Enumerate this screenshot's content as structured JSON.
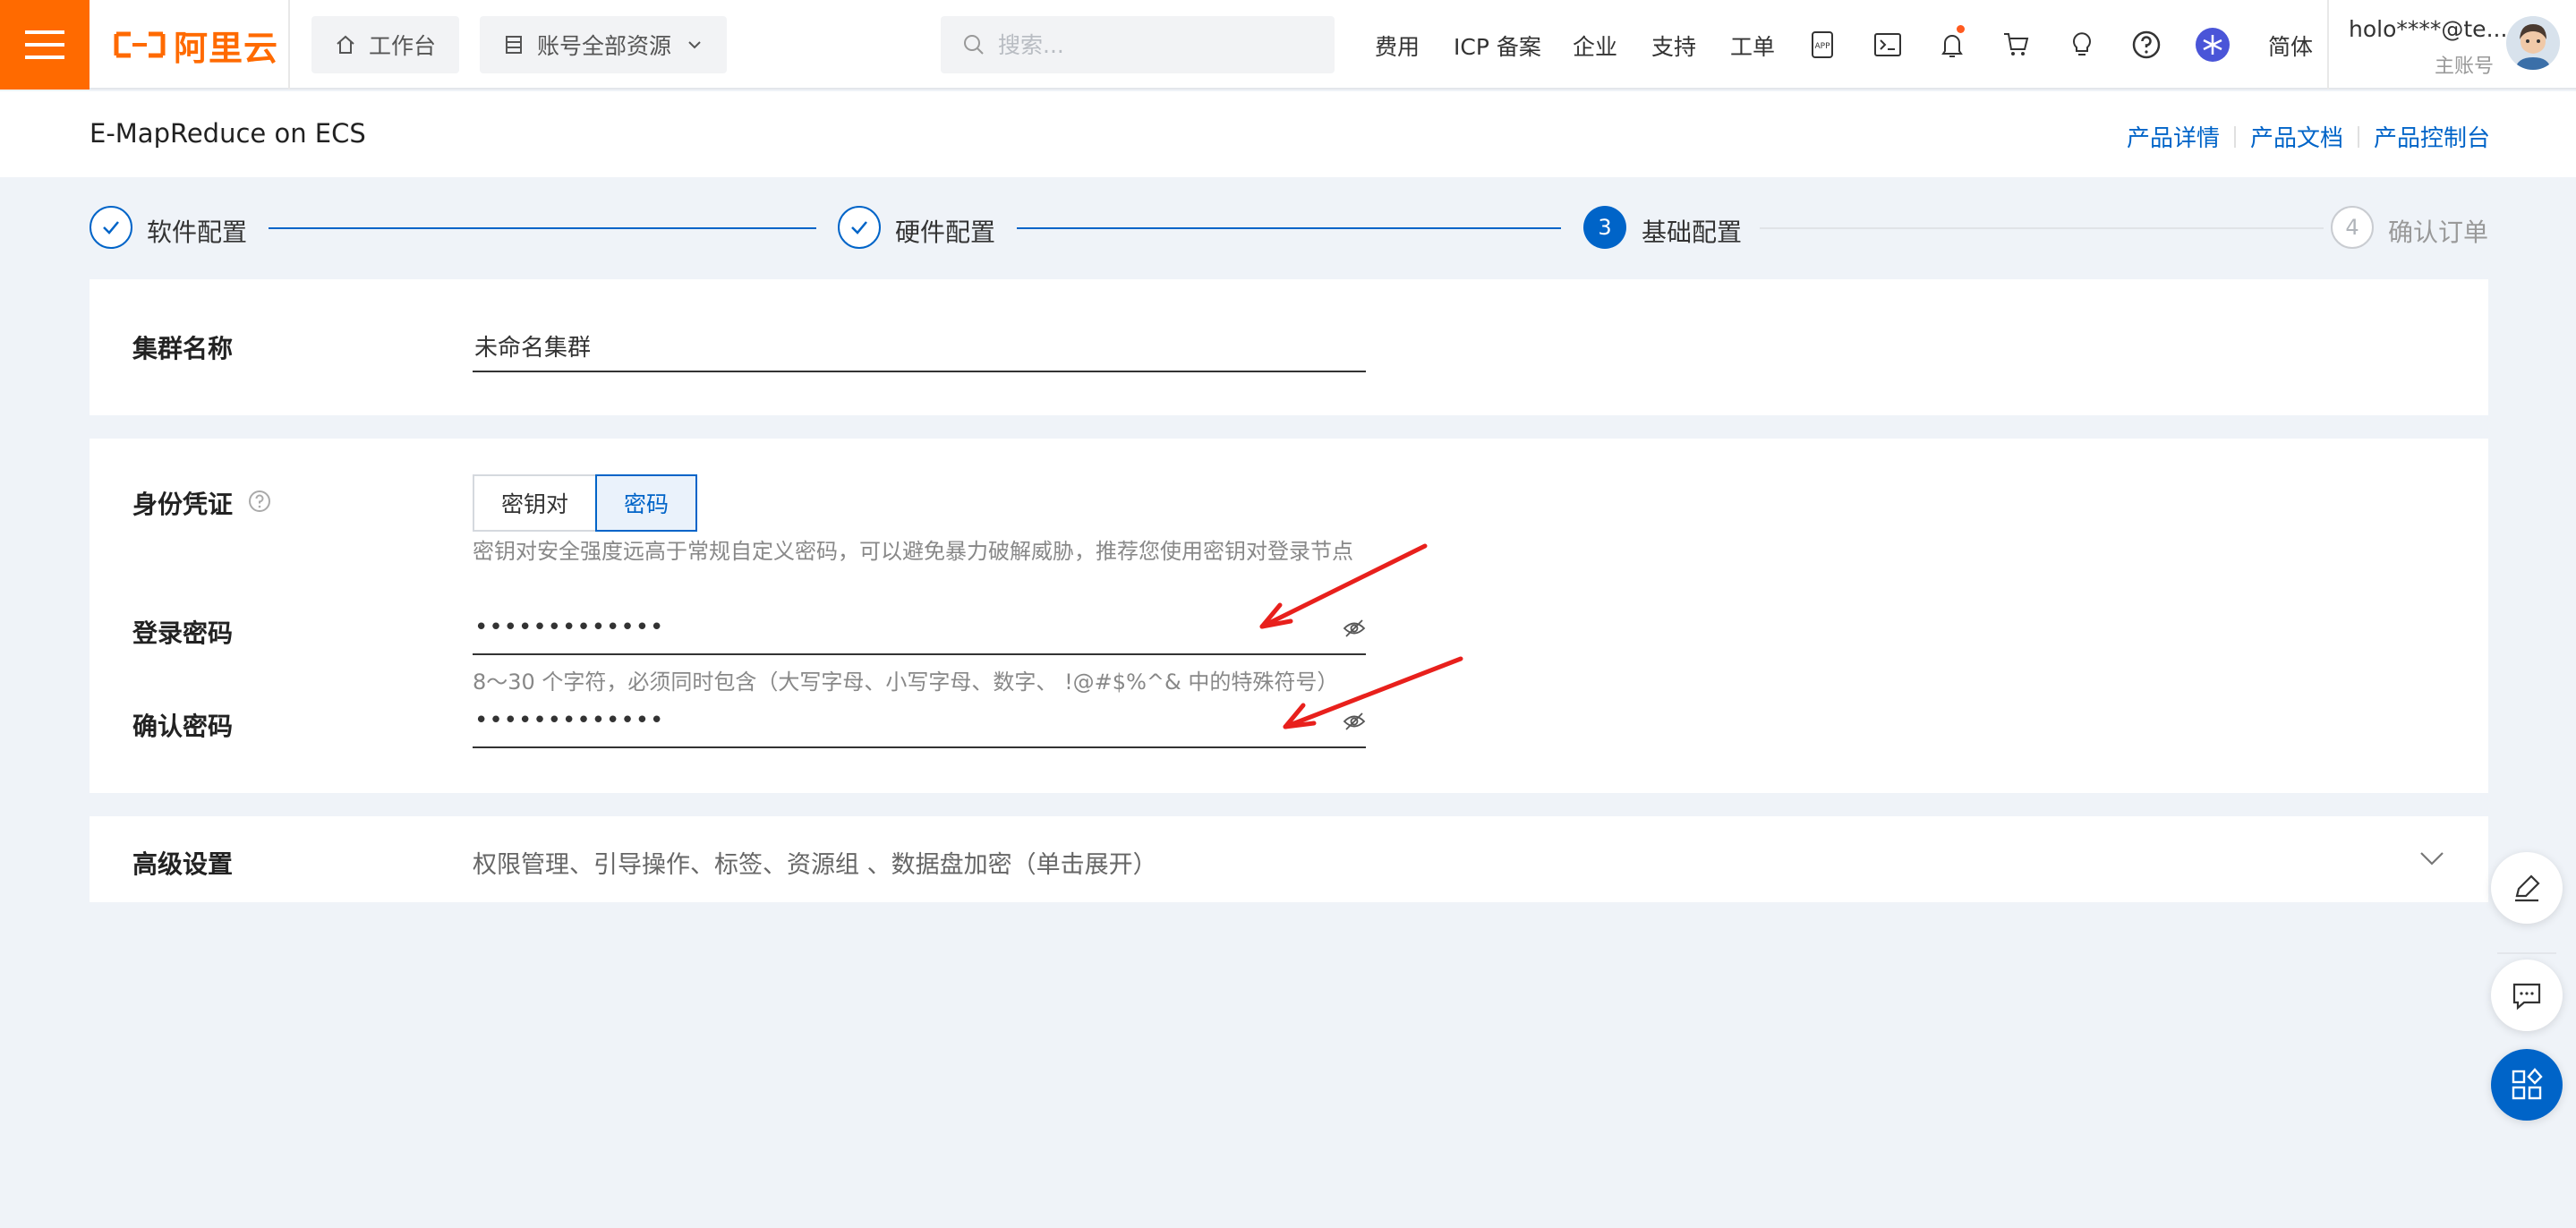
{
  "topbar": {
    "logo_text": "阿里云",
    "workbench": "工作台",
    "resources": "账号全部资源",
    "search_placeholder": "搜索...",
    "nav": [
      "费用",
      "ICP 备案",
      "企业",
      "支持",
      "工单"
    ],
    "language": "简体",
    "user_name": "holo****@te...",
    "user_role": "主账号",
    "brand_color": "#ff6a00"
  },
  "subheader": {
    "product": "E-MapReduce on ECS",
    "links": [
      "产品详情",
      "产品文档",
      "产品控制台"
    ]
  },
  "steps": [
    {
      "label": "软件配置",
      "state": "done"
    },
    {
      "label": "硬件配置",
      "state": "done"
    },
    {
      "label": "基础配置",
      "state": "active",
      "number": "3"
    },
    {
      "label": "确认订单",
      "state": "todo",
      "number": "4"
    }
  ],
  "cluster": {
    "label": "集群名称",
    "value": "未命名集群"
  },
  "credential": {
    "label": "身份凭证",
    "options": [
      "密钥对",
      "密码"
    ],
    "selected": "密码",
    "hint": "密钥对安全强度远高于常规自定义密码，可以避免暴力破解威胁，推荐您使用密钥对登录节点",
    "login_label": "登录密码",
    "login_value": "•••••••••••••",
    "password_hint": "8～30 个字符，必须同时包含（大写字母、小写字母、数字、 !@#$%^& 中的特殊符号）",
    "confirm_label": "确认密码",
    "confirm_value": "•••••••••••••"
  },
  "advanced": {
    "label": "高级设置",
    "summary": "权限管理、引导操作、标签、资源组 、数据盘加密（单击展开）"
  },
  "colors": {
    "accent": "#0064c8",
    "annotation_arrow": "#e8201c"
  }
}
